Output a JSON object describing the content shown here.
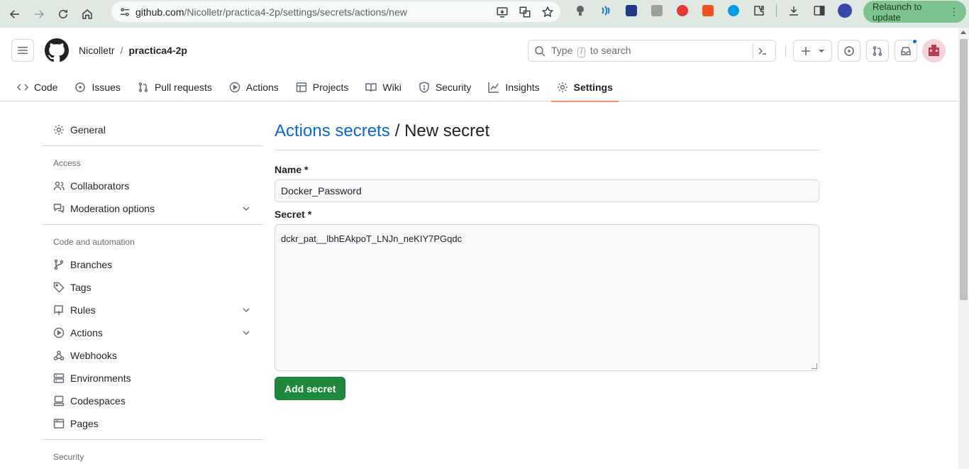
{
  "browser": {
    "url_host": "github.com",
    "url_path": "/Nicolletr/practica4-2p/settings/secrets/actions/new",
    "relaunch_label": "Relaunch to update"
  },
  "header": {
    "owner": "Nicolletr",
    "separator": "/",
    "repo": "practica4-2p",
    "search_prefix": "Type",
    "search_key": "/",
    "search_suffix": "to search"
  },
  "tabs": [
    {
      "label": "Code"
    },
    {
      "label": "Issues"
    },
    {
      "label": "Pull requests"
    },
    {
      "label": "Actions"
    },
    {
      "label": "Projects"
    },
    {
      "label": "Wiki"
    },
    {
      "label": "Security"
    },
    {
      "label": "Insights"
    },
    {
      "label": "Settings"
    }
  ],
  "sidebar": {
    "general": "General",
    "access_heading": "Access",
    "collaborators": "Collaborators",
    "moderation": "Moderation options",
    "code_heading": "Code and automation",
    "branches": "Branches",
    "tags": "Tags",
    "rules": "Rules",
    "actions": "Actions",
    "webhooks": "Webhooks",
    "environments": "Environments",
    "codespaces": "Codespaces",
    "pages": "Pages",
    "security_heading": "Security"
  },
  "main": {
    "title_link": "Actions secrets",
    "title_rest": "/ New secret",
    "name_label": "Name *",
    "name_value": "Docker_Password",
    "secret_label": "Secret *",
    "secret_value": "dckr_pat__lbhEAkpoT_LNJn_neKIY7PGqdc",
    "submit_label": "Add secret"
  },
  "colors": {
    "accent_link": "#0969da",
    "primary_button": "#1f883d",
    "active_tab_underline": "#fd8c73",
    "browser_bar": "#dfe9e1",
    "relaunch_pill": "#7dc491"
  }
}
